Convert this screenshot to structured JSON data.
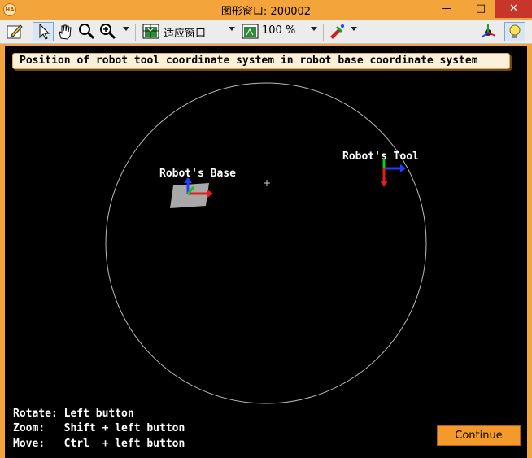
{
  "window": {
    "title": "图形窗口: 200002",
    "app_icon": "HA",
    "controls": {
      "minimize": "—",
      "maximize": "□",
      "close": "✕"
    }
  },
  "toolbar": {
    "zoom_mode_label": "适应窗口",
    "zoom_percent_label": "100 %",
    "icons": [
      "edit-icon",
      "pointer-icon",
      "hand-icon",
      "magnify-icon",
      "zoom-in-icon",
      "fit-window-icon",
      "zoom-percent-icon",
      "paint-icon",
      "axes-icon",
      "lightbulb-icon"
    ]
  },
  "canvas": {
    "banner": "Position of robot tool coordinate system in robot base coordinate system",
    "base_label": "Robot's Base",
    "tool_label": "Robot's Tool",
    "hints": {
      "rotate": "Rotate: Left button",
      "zoom": "Zoom:   Shift + left button",
      "move": "Move:   Ctrl  + left button"
    },
    "continue_label": "Continue"
  },
  "colors": {
    "frame": "#f3a43b",
    "canvas_bg": "#000000",
    "axis_x": "#e02020",
    "axis_y": "#20c020",
    "axis_z": "#2040ff",
    "circle": "#bbbbbb"
  }
}
